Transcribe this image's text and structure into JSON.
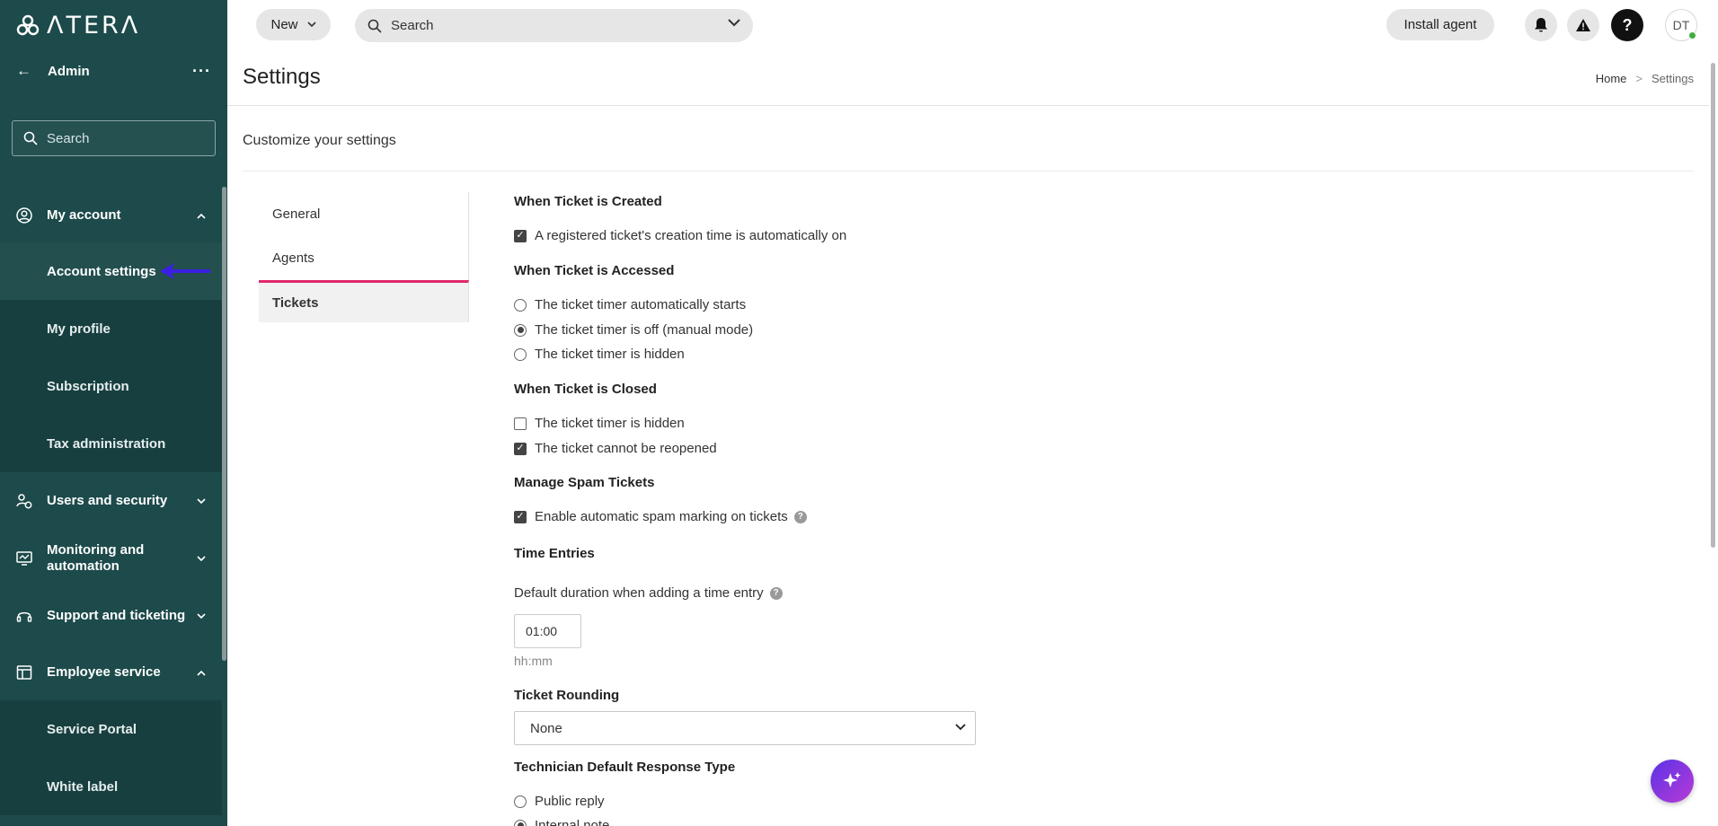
{
  "brand": {
    "logo_text": "ΛTERΛ"
  },
  "sidebar": {
    "header_label": "Admin",
    "search_placeholder": "Search",
    "groups": [
      {
        "label": "My account",
        "icon": "user-circle-icon",
        "expanded": true,
        "items": [
          {
            "label": "Account settings",
            "active": true
          },
          {
            "label": "My profile"
          },
          {
            "label": "Subscription"
          },
          {
            "label": "Tax administration"
          }
        ]
      },
      {
        "label": "Users and security",
        "icon": "users-security-icon",
        "expanded": false
      },
      {
        "label": "Monitoring and automation",
        "icon": "monitor-icon",
        "expanded": false
      },
      {
        "label": "Support and ticketing",
        "icon": "headset-icon",
        "expanded": false
      },
      {
        "label": "Employee service",
        "icon": "service-window-icon",
        "expanded": true,
        "items": [
          {
            "label": "Service Portal"
          },
          {
            "label": "White label"
          }
        ]
      }
    ]
  },
  "topbar": {
    "new_label": "New",
    "search_placeholder": "Search",
    "install_label": "Install agent",
    "help_label": "?",
    "avatar_initials": "DT",
    "status_color": "#3fae3f"
  },
  "page": {
    "title": "Settings",
    "breadcrumb": {
      "home": "Home",
      "sep": ">",
      "current": "Settings"
    },
    "subtitle": "Customize your settings"
  },
  "tabs": [
    {
      "label": "General",
      "active": false
    },
    {
      "label": "Agents",
      "active": false
    },
    {
      "label": "Tickets",
      "active": true
    }
  ],
  "form": {
    "created": {
      "heading": "When Ticket is Created",
      "option": "A registered ticket's creation time is automatically on",
      "checked": true
    },
    "accessed": {
      "heading": "When Ticket is Accessed",
      "options": [
        {
          "label": "The ticket timer automatically starts",
          "selected": false
        },
        {
          "label": "The ticket timer is off (manual mode)",
          "selected": true
        },
        {
          "label": "The ticket timer is hidden",
          "selected": false
        }
      ]
    },
    "closed": {
      "heading": "When Ticket is Closed",
      "options": [
        {
          "label": "The ticket timer is hidden",
          "checked": false
        },
        {
          "label": "The ticket cannot be reopened",
          "checked": true
        }
      ]
    },
    "spam": {
      "heading": "Manage Spam Tickets",
      "option": "Enable automatic spam marking on tickets",
      "checked": true
    },
    "time_entries": {
      "heading": "Time Entries",
      "duration_label": "Default duration when adding a time entry",
      "duration_value": "01:00",
      "duration_hint": "hh:mm"
    },
    "rounding": {
      "heading": "Ticket Rounding",
      "selected": "None"
    },
    "response": {
      "heading": "Technician Default Response Type",
      "options": [
        {
          "label": "Public reply",
          "selected": false
        },
        {
          "label": "Internal note",
          "selected": true
        }
      ]
    }
  },
  "colors": {
    "sidebar_bg": "#1d4a4a",
    "tab_accent": "#e0286c",
    "ai_gradient_start": "#5a33e6",
    "ai_gradient_end": "#b83ad6",
    "pointer_arrow": "#3b1fe0"
  }
}
